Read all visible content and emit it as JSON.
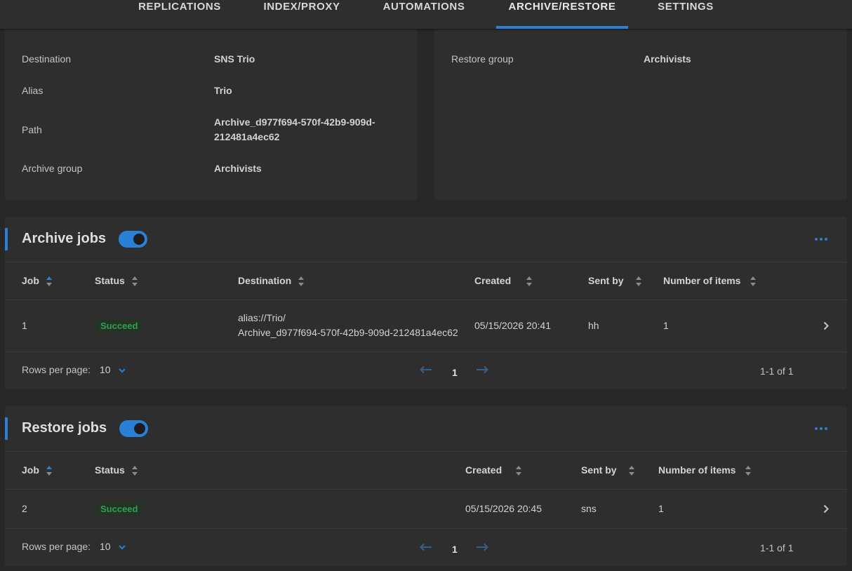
{
  "tabs": [
    {
      "label": "REPLICATIONS",
      "active": false
    },
    {
      "label": "INDEX/PROXY",
      "active": false
    },
    {
      "label": "AUTOMATIONS",
      "active": false
    },
    {
      "label": "ARCHIVE/RESTORE",
      "active": true
    },
    {
      "label": "SETTINGS",
      "active": false
    }
  ],
  "archive_info": {
    "destination_label": "Destination",
    "destination_value": "SNS Trio",
    "alias_label": "Alias",
    "alias_value": "Trio",
    "path_label": "Path",
    "path_value_line1": "Archive_d977f694-570f-42b9-909d-",
    "path_value_line2": "212481a4ec62",
    "group_label": "Archive group",
    "group_value": "Archivists"
  },
  "restore_info": {
    "group_label": "Restore group",
    "group_value": "Archivists"
  },
  "archive_jobs": {
    "title": "Archive jobs",
    "toggle_on": true,
    "columns": [
      "Job",
      "Status",
      "Destination",
      "Created",
      "Sent by",
      "Number of items"
    ],
    "rows": [
      {
        "job": "1",
        "status": "Succeed",
        "destination_line1": "alias://Trio/",
        "destination_line2": "Archive_d977f694-570f-42b9-909d-212481a4ec62",
        "created": "05/15/2026 20:41",
        "sent_by": "hh",
        "items": "1"
      }
    ],
    "rows_per_page_label": "Rows per page:",
    "rows_per_page_value": "10",
    "page": "1",
    "range": "1-1 of 1"
  },
  "restore_jobs": {
    "title": "Restore jobs",
    "toggle_on": true,
    "columns": [
      "Job",
      "Status",
      "Created",
      "Sent by",
      "Number of items"
    ],
    "rows": [
      {
        "job": "2",
        "status": "Succeed",
        "created": "05/15/2026 20:45",
        "sent_by": "sns",
        "items": "1"
      }
    ],
    "rows_per_page_label": "Rows per page:",
    "rows_per_page_value": "10",
    "page": "1",
    "range": "1-1 of 1"
  },
  "colors": {
    "accent": "#2a7fd6",
    "success": "#2fa14f",
    "background": "#272727",
    "surface": "#2e2e2e"
  },
  "icons": [
    "sort-icon",
    "chevron-down-icon",
    "chevron-right-icon",
    "arrow-left-icon",
    "arrow-right-icon",
    "more-horizontal-icon"
  ]
}
